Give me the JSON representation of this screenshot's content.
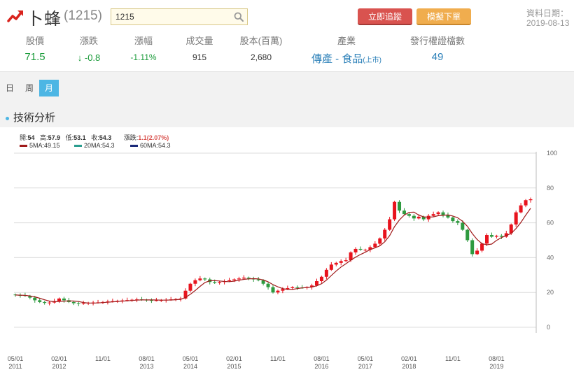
{
  "header": {
    "stock_name": "卜蜂",
    "stock_code": "(1215)",
    "search_value": "1215",
    "btn_trade": "立即追蹤",
    "btn_sim": "模擬下單",
    "date_label": "資料日期：",
    "date_value": "2019-08-13"
  },
  "stats": {
    "price_label": "股價",
    "price": "71.5",
    "change_label": "漲跌",
    "change": "-0.8",
    "pct_label": "漲幅",
    "pct": "-1.11%",
    "volume_label": "成交量",
    "volume": "915",
    "capital_label": "股本(百萬)",
    "capital": "2,680",
    "industry_label": "產業",
    "industry": "傳產 - 食品",
    "industry_tag": "(上市)",
    "warrant_label": "發行權證檔數",
    "warrants": "49"
  },
  "tabs": [
    "日",
    "周",
    "月"
  ],
  "active_tab": "月",
  "section_title": "技術分析",
  "legend": {
    "open_label": "開:",
    "open": "54",
    "high_label": "高:",
    "high": "57.9",
    "low_label": "低:",
    "low": "53.1",
    "close_label": "收:",
    "close": "54.3",
    "chg_label": "漲跌:",
    "chg": "1.1(2.07%)",
    "ma5": "5MA:49.15",
    "ma20": "20MA:54.3",
    "ma60": "60MA:54.3"
  },
  "colors": {
    "up": "#e8131d",
    "down": "#2e9a3f",
    "ma5": "#a01a1a",
    "ma20": "#2a9d8f",
    "ma60": "#1a2a7a",
    "accent": "#4db6e4"
  },
  "chart_data": {
    "type": "candlestick",
    "ylim": [
      0,
      100
    ],
    "y_ticks": [
      0,
      20,
      40,
      60,
      80,
      100
    ],
    "x_ticks": [
      {
        "label": "05/01",
        "year": "2011",
        "index": 0
      },
      {
        "label": "02/01",
        "year": "2012",
        "index": 9
      },
      {
        "label": "11/01",
        "year": "",
        "index": 18
      },
      {
        "label": "08/01",
        "year": "2013",
        "index": 27
      },
      {
        "label": "05/01",
        "year": "2014",
        "index": 36
      },
      {
        "label": "02/01",
        "year": "2015",
        "index": 45
      },
      {
        "label": "11/01",
        "year": "",
        "index": 54
      },
      {
        "label": "08/01",
        "year": "2016",
        "index": 63
      },
      {
        "label": "05/01",
        "year": "2017",
        "index": 72
      },
      {
        "label": "02/01",
        "year": "2018",
        "index": 81
      },
      {
        "label": "11/01",
        "year": "",
        "index": 90
      },
      {
        "label": "08/01",
        "year": "2019",
        "index": 99
      }
    ],
    "closes": [
      18.5,
      18.4,
      18,
      17,
      15.5,
      14.5,
      14,
      14.2,
      15,
      16.5,
      15.5,
      14.5,
      13.8,
      13.5,
      13.8,
      14,
      14.2,
      14.3,
      14.5,
      14.8,
      15,
      15.2,
      15.4,
      15.6,
      15.8,
      16,
      15.8,
      15.6,
      15.4,
      15.5,
      15.6,
      15.8,
      16,
      16.2,
      16.5,
      21,
      25,
      27,
      28,
      27.5,
      26,
      25.5,
      26,
      26.5,
      27,
      27.5,
      28,
      28.5,
      28,
      27.5,
      27,
      25,
      23,
      20,
      21,
      22,
      22.5,
      23,
      22.8,
      22.7,
      23,
      24,
      26.5,
      29,
      33,
      36,
      37,
      38,
      38.5,
      43,
      45,
      44.5,
      44.5,
      46,
      48,
      51,
      56,
      62,
      72,
      67,
      65,
      64,
      62.5,
      63.5,
      62,
      64,
      65,
      66,
      64.5,
      63,
      61,
      60,
      56,
      50,
      42,
      44,
      48,
      53,
      52,
      52.5,
      52,
      54,
      59,
      66,
      70,
      73,
      73.5
    ]
  }
}
